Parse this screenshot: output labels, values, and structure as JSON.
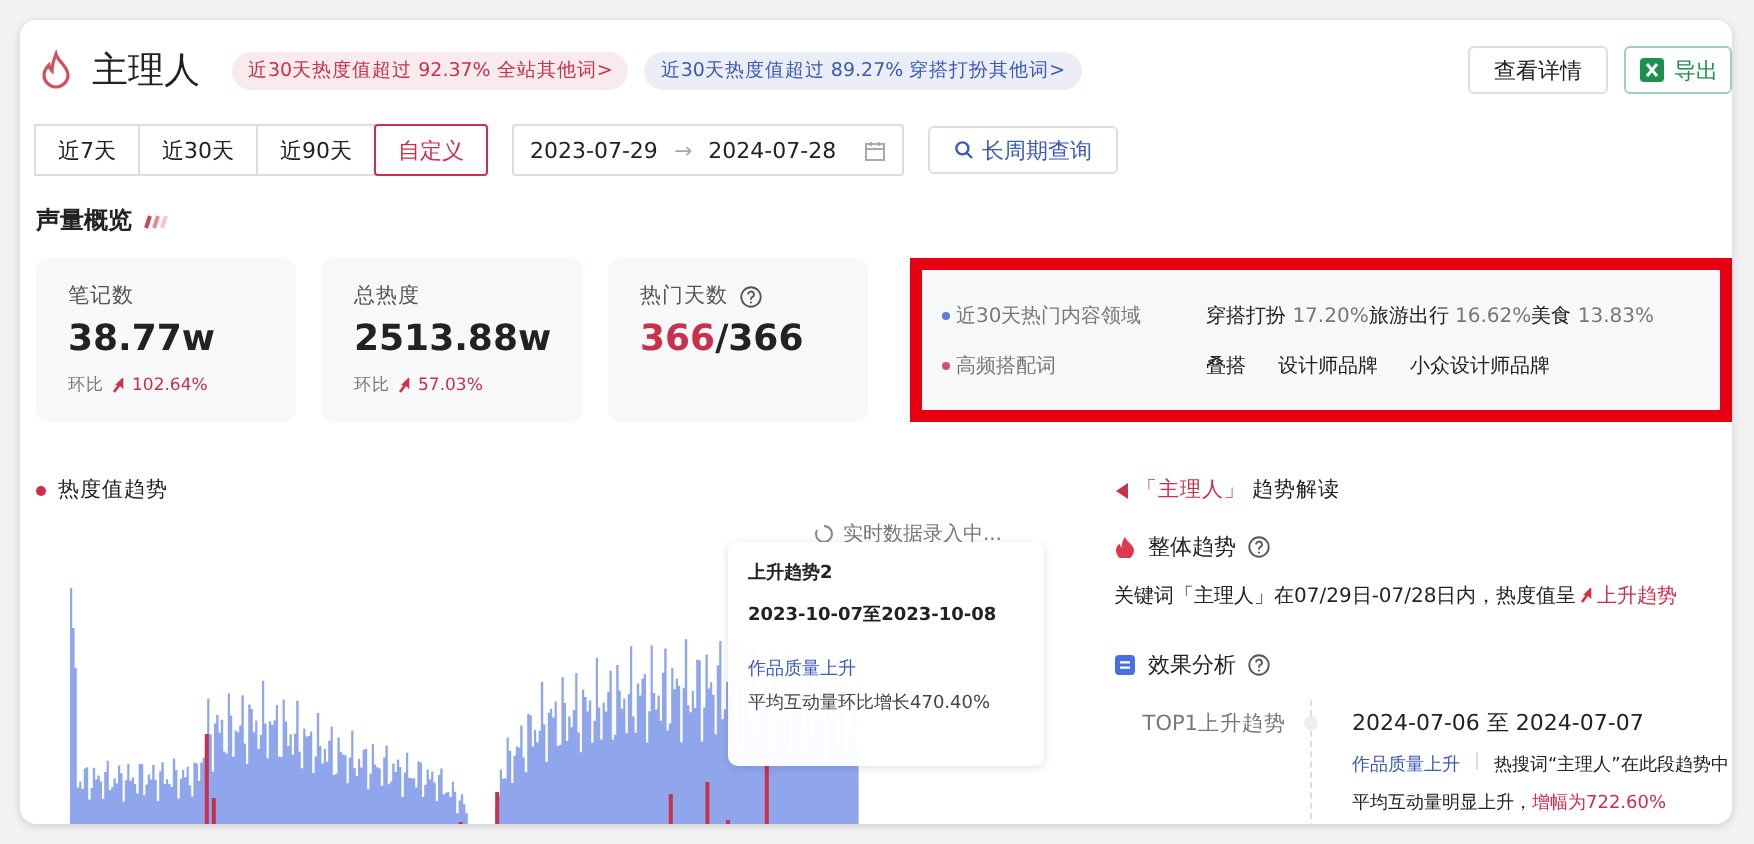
{
  "header": {
    "title": "主理人",
    "badges": [
      {
        "text": "近30天热度值超过 92.37% 全站其他词>",
        "color": "#c9304c"
      },
      {
        "text": "近30天热度值超过 89.27% 穿搭打扮其他词>",
        "color": "#3a5bb5"
      }
    ],
    "buttons": [
      {
        "label": "查看详情",
        "kind": "plain"
      },
      {
        "label": "导出",
        "kind": "excel"
      }
    ]
  },
  "range_tabs": [
    {
      "label": "近7天",
      "selected": false
    },
    {
      "label": "近30天",
      "selected": false
    },
    {
      "label": "近90天",
      "selected": false
    },
    {
      "label": "自定义",
      "selected": true
    }
  ],
  "date_range": {
    "start": "2023-07-29",
    "separator": "→",
    "end": "2024-07-28"
  },
  "long_query": "长周期查询",
  "overview": {
    "title": "声量概览",
    "stats": [
      {
        "kind": "change",
        "label": "笔记数",
        "value": "38.77w",
        "compare_label": "环比",
        "change": "102.64%"
      },
      {
        "kind": "change",
        "label": "总热度",
        "value": "2513.88w",
        "compare_label": "环比",
        "change": "57.03%"
      },
      {
        "kind": "ratio",
        "label": "热门天数",
        "hot": "366",
        "total": "/366"
      }
    ],
    "highlight_rows": [
      {
        "kind": "domains",
        "label": "近30天热门内容领域",
        "color": "#5b7bd5",
        "items": [
          {
            "name": "穿搭打扮",
            "share": "17.20%"
          },
          {
            "name": "旅游出行",
            "share": "16.62%"
          },
          {
            "name": "美食",
            "share": "13.83%"
          }
        ]
      },
      {
        "kind": "words",
        "label": "高频搭配词",
        "color": "#d0506a",
        "items": [
          {
            "name": "叠搭"
          },
          {
            "name": "设计师品牌"
          },
          {
            "name": "小众设计师品牌"
          }
        ]
      }
    ]
  },
  "trend": {
    "title": "热度值趋势",
    "status": "实时数据录入中...",
    "tooltip": {
      "title": "上升趋势2",
      "dates": "2023-10-07至2023-10-08",
      "reason": "作品质量上升",
      "detail": "平均互动量环比增长470.40%"
    }
  },
  "interpretation": {
    "keyword": "「主理人」",
    "title": "趋势解读",
    "overall": {
      "title": "整体趋势",
      "text": "关键词「主理人」在07/29日-07/28日内，热度值呈",
      "trend": "上升趋势"
    },
    "analysis": {
      "title": "效果分析",
      "rank": "TOP1上升趋势",
      "dates": "2024-07-06 至 2024-07-07",
      "tag": "作品质量上升",
      "text": "热搜词“主理人”在此段趋势中平均互动量明显上升，",
      "highlight": "增幅为722.60%"
    }
  }
}
